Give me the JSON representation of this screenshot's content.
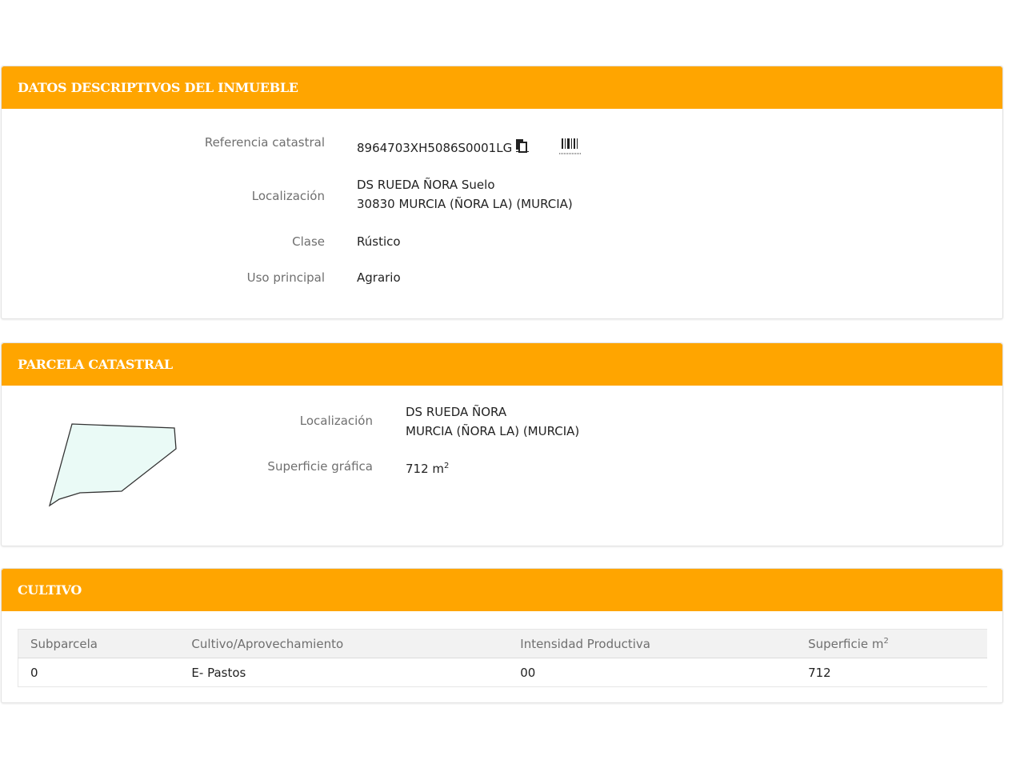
{
  "descriptivos": {
    "title": "DATOS DESCRIPTIVOS DEL INMUEBLE",
    "ref_label": "Referencia catastral",
    "ref_value": "8964703XH5086S0001LG",
    "loc_label": "Localización",
    "loc_line1": "DS RUEDA ÑORA Suelo",
    "loc_line2": "30830 MURCIA (ÑORA LA) (MURCIA)",
    "clase_label": "Clase",
    "clase_value": "Rústico",
    "uso_label": "Uso principal",
    "uso_value": "Agrario"
  },
  "parcela": {
    "title": "PARCELA CATASTRAL",
    "loc_label": "Localización",
    "loc_line1": "DS RUEDA ÑORA",
    "loc_line2": "MURCIA (ÑORA LA) (MURCIA)",
    "sup_label": "Superficie gráfica",
    "sup_value": "712 m",
    "sup_exp": "2",
    "shape_fill": "#eafaf6"
  },
  "cultivo": {
    "title": "CULTIVO",
    "headers": {
      "subparcela": "Subparcela",
      "cultivo": "Cultivo/Aprovechamiento",
      "intensidad": "Intensidad Productiva",
      "superficie": "Superficie m",
      "superficie_exp": "2"
    },
    "rows": [
      {
        "subparcela": "0",
        "cultivo": "E- Pastos",
        "intensidad": "00",
        "superficie": "712"
      }
    ]
  },
  "colors": {
    "accent": "#ffa500",
    "label": "#6f6f6f"
  },
  "icons": {
    "copy": "copy-icon",
    "barcode": "barcode-icon"
  }
}
